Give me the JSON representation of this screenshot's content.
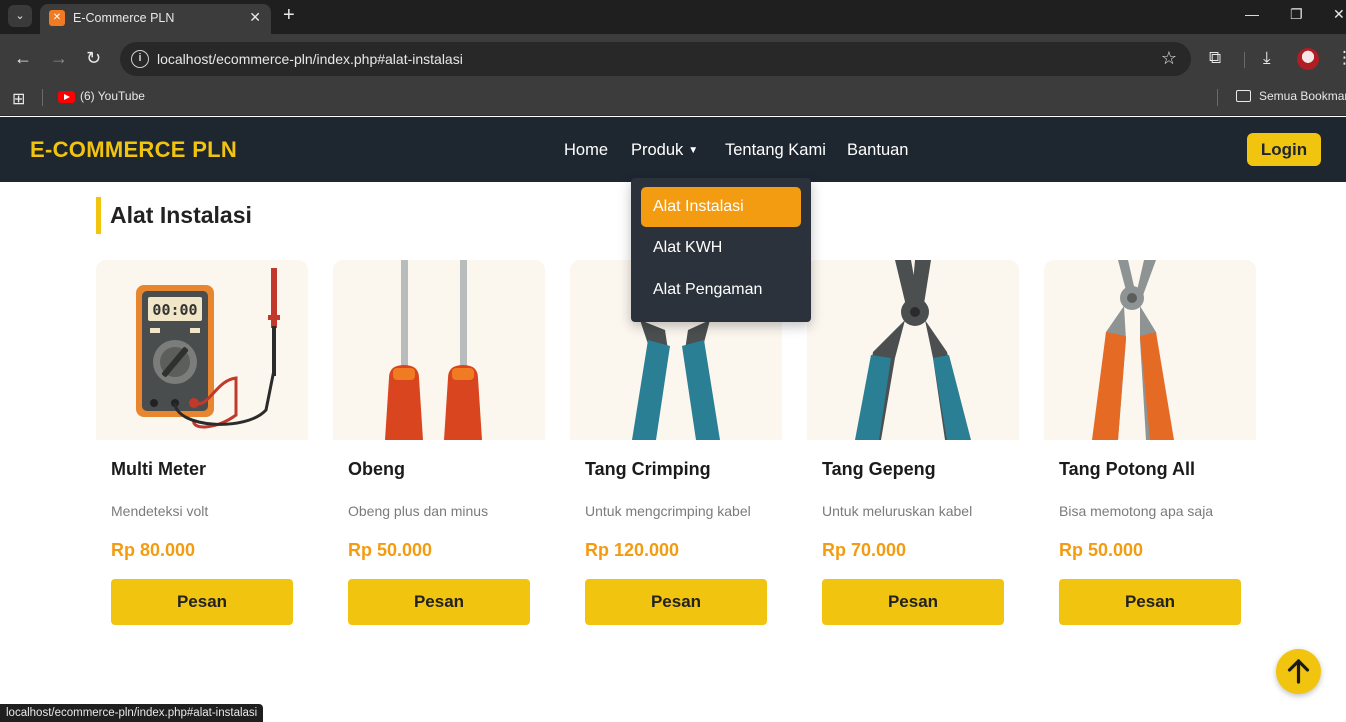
{
  "browser": {
    "tab_title": "E-Commerce PLN",
    "url": "localhost/ecommerce-pln/index.php#alat-instalasi",
    "bookmarks": [
      {
        "label": "(6) YouTube"
      }
    ],
    "bookmarks_folder": "Semua Bookmark",
    "status_url": "localhost/ecommerce-pln/index.php#alat-instalasi",
    "icons": [
      "tab-search-icon",
      "xampp-favicon",
      "close-icon",
      "plus-icon",
      "minimize-icon",
      "restore-icon",
      "window-close-icon",
      "back-icon",
      "forward-icon",
      "reload-icon",
      "site-info-icon",
      "star-icon",
      "extensions-icon",
      "download-icon",
      "profile-avatar",
      "more-icon",
      "apps-icon",
      "youtube-icon",
      "folder-icon"
    ]
  },
  "header": {
    "brand": "E-COMMERCE PLN",
    "nav": [
      "Home",
      "Produk",
      "Tentang Kami",
      "Bantuan"
    ],
    "login": "Login"
  },
  "dropdown": {
    "items": [
      "Alat Instalasi",
      "Alat KWH",
      "Alat Pengaman"
    ],
    "active_index": 0
  },
  "section": {
    "title": "Alat Instalasi"
  },
  "products": [
    {
      "name": "Multi Meter",
      "desc": "Mendeteksi volt",
      "price": "Rp 80.000",
      "button": "Pesan"
    },
    {
      "name": "Obeng",
      "desc": "Obeng plus dan minus",
      "price": "Rp 50.000",
      "button": "Pesan"
    },
    {
      "name": "Tang Crimping",
      "desc": "Untuk mengcrimping kabel",
      "price": "Rp 120.000",
      "button": "Pesan"
    },
    {
      "name": "Tang Gepeng",
      "desc": "Untuk meluruskan kabel",
      "price": "Rp 70.000",
      "button": "Pesan"
    },
    {
      "name": "Tang Potong All",
      "desc": "Bisa memotong apa saja",
      "price": "Rp 50.000",
      "button": "Pesan"
    }
  ],
  "colors": {
    "header_bg": "#1e2630",
    "brand": "#f1c40f",
    "accent": "#f39c12",
    "button": "#f1c40f"
  },
  "misc": {
    "scroll_top_icon": "arrow-up-icon"
  }
}
